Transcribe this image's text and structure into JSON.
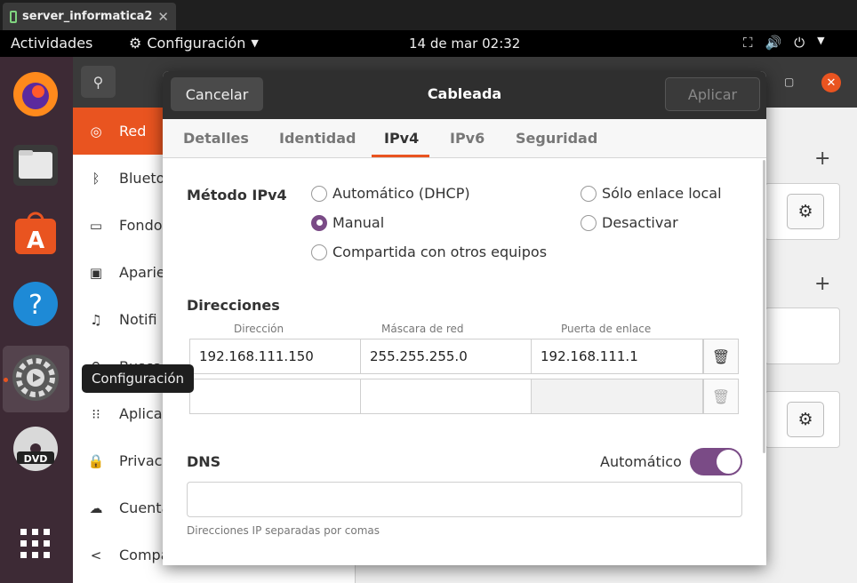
{
  "vm_tab": {
    "title": "server_informatica2",
    "close": "✕"
  },
  "topbar": {
    "activities": "Actividades",
    "app_menu": "Configuración",
    "clock": "14 de mar  02:32"
  },
  "dock": {
    "apps": [
      "firefox-icon",
      "files-icon",
      "software-icon",
      "help-icon",
      "settings-icon",
      "dvd-icon",
      "show-apps-icon"
    ]
  },
  "tooltip": "Configuración",
  "sidebar": {
    "items": [
      {
        "label": "Red",
        "icon": "network-icon"
      },
      {
        "label": "Blueto",
        "icon": "bluetooth-icon"
      },
      {
        "label": "Fondo",
        "icon": "background-icon"
      },
      {
        "label": "Aparie",
        "icon": "appearance-icon"
      },
      {
        "label": "Notifi",
        "icon": "notifications-icon"
      },
      {
        "label": "Buscar",
        "icon": "search-icon"
      },
      {
        "label": "Aplica",
        "icon": "apps-icon"
      },
      {
        "label": "Privaci",
        "icon": "privacy-icon"
      },
      {
        "label": "Cuenta",
        "icon": "accounts-icon"
      },
      {
        "label": "Compa",
        "icon": "share-icon"
      }
    ]
  },
  "dialog": {
    "title": "Cableada",
    "cancel": "Cancelar",
    "apply": "Aplicar",
    "tabs": [
      "Detalles",
      "Identidad",
      "IPv4",
      "IPv6",
      "Seguridad"
    ],
    "active_tab": "IPv4",
    "method_label": "Método IPv4",
    "methods": {
      "dhcp": "Automático (DHCP)",
      "link_local": "Sólo enlace local",
      "manual": "Manual",
      "disable": "Desactivar",
      "shared": "Compartida con otros equipos"
    },
    "selected_method": "Manual",
    "addresses_label": "Direcciones",
    "columns": [
      "Dirección",
      "Máscara de red",
      "Puerta de enlace"
    ],
    "rows": [
      {
        "address": "192.168.111.150",
        "netmask": "255.255.255.0",
        "gateway": "192.168.111.1"
      },
      {
        "address": "",
        "netmask": "",
        "gateway": ""
      }
    ],
    "dns_label": "DNS",
    "dns_auto_label": "Automático",
    "dns_auto": true,
    "dns_value": "",
    "dns_hint": "Direcciones IP separadas por comas"
  },
  "colors": {
    "accent": "#e95420",
    "toggle": "#7a4b86"
  }
}
